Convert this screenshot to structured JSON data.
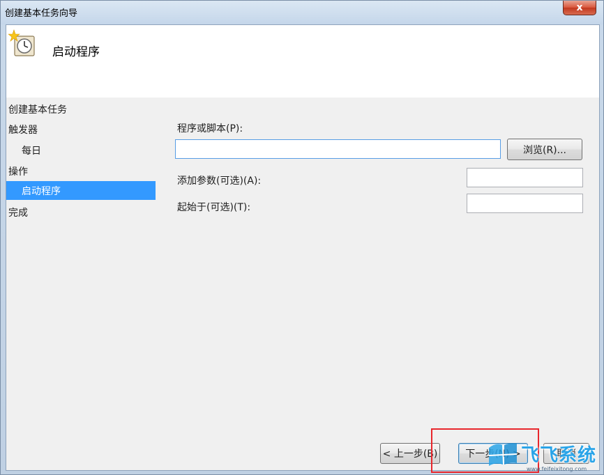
{
  "window": {
    "title": "创建基本任务向导",
    "close_glyph": "x"
  },
  "header": {
    "title": "启动程序",
    "icon": "task-clock-icon"
  },
  "nav": {
    "items": [
      {
        "label": "创建基本任务"
      },
      {
        "label": "触发器"
      },
      {
        "label": "每日"
      },
      {
        "label": "操作"
      },
      {
        "label": "启动程序"
      },
      {
        "label": "完成"
      }
    ],
    "selected": "启动程序"
  },
  "form": {
    "program_label": "程序或脚本(P):",
    "program_value": "",
    "browse_label": "浏览(R)...",
    "args_label": "添加参数(可选)(A):",
    "args_value": "",
    "start_label": "起始于(可选)(T):",
    "start_value": ""
  },
  "footer": {
    "back_label": "< 上一步(B)",
    "next_label": "下一步(N) >",
    "cancel_label": "取消"
  },
  "watermark": {
    "brand": "飞飞系统",
    "url": "www.feifeixitong.com"
  },
  "colors": {
    "selection": "#3399ff",
    "highlight_box": "#e8262c",
    "watermark": "#2aa4e8"
  }
}
